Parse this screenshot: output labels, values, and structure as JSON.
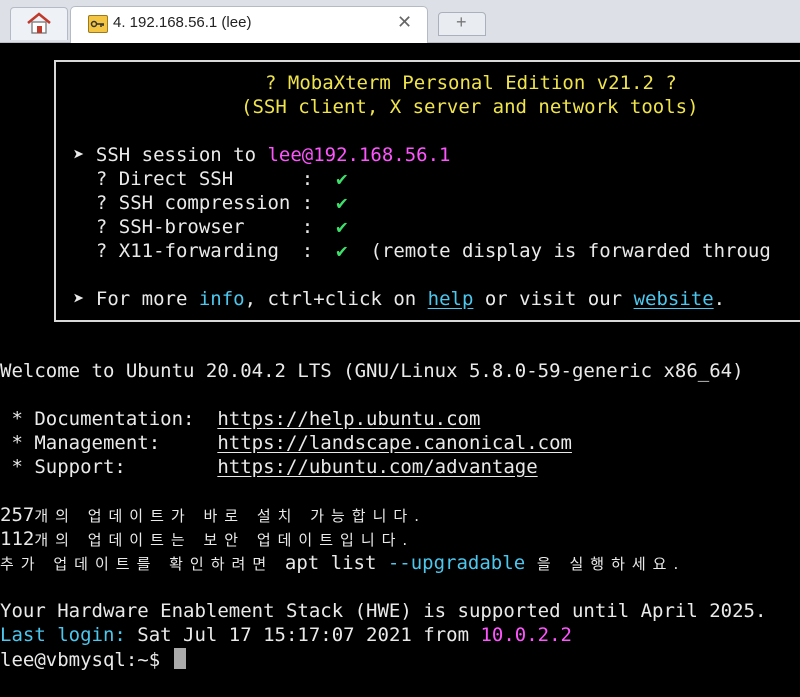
{
  "tabs": {
    "home_icon": "home-icon",
    "active": {
      "title": "4. 192.168.56.1 (lee)",
      "icon": "ssh-key-icon",
      "close": "✕"
    },
    "new_tab": "+"
  },
  "colors": {
    "yellow": "#f0e44b",
    "magenta": "#ff55ff",
    "green": "#3ce06a",
    "cyan": "#4cc7ee",
    "text": "#eaeaea"
  },
  "banner": {
    "title": "? MobaXterm Personal Edition v21.2 ?",
    "subtitle": "(SSH client, X server and network tools)",
    "session_prefix": "➤ SSH session to ",
    "session_host": "lee@192.168.56.1",
    "features": [
      {
        "label": "  ? Direct SSH      :  ",
        "check": "✔",
        "note": ""
      },
      {
        "label": "  ? SSH compression :  ",
        "check": "✔",
        "note": ""
      },
      {
        "label": "  ? SSH-browser     :  ",
        "check": "✔",
        "note": ""
      },
      {
        "label": "  ? X11-forwarding  :  ",
        "check": "✔",
        "note": "  (remote display is forwarded throug"
      }
    ],
    "more": {
      "p1": "➤ For more ",
      "info": "info",
      "p2": ", ctrl+click on ",
      "help": "help",
      "p3": " or visit our ",
      "website": "website",
      "p4": "."
    }
  },
  "welcome": "Welcome to Ubuntu 20.04.2 LTS (GNU/Linux 5.8.0-59-generic x86_64)",
  "docs": [
    {
      "label": " * Documentation:  ",
      "url": "https://help.ubuntu.com"
    },
    {
      "label": " * Management:     ",
      "url": "https://landscape.canonical.com"
    },
    {
      "label": " * Support:        ",
      "url": "https://ubuntu.com/advantage"
    }
  ],
  "updates": {
    "l1_num": "257",
    "l1_text": "개의 업데이트가 바로 설치 가능합니다.",
    "l2_num": "112",
    "l2_text": "개의 업데이트는 보안 업데이트입니다.",
    "l3_pre": "추가 업데이트를 확인하려면 ",
    "l3_cmd": "apt list ",
    "l3_opt": "--upgradable",
    "l3_post": " 을 실행하세요."
  },
  "hwe": "Your Hardware Enablement Stack (HWE) is supported until April 2025.",
  "last_login": {
    "label": "Last login:",
    "value": " Sat Jul 17 15:17:07 2021 from ",
    "ip": "10.0.2.2"
  },
  "prompt": "lee@vbmysql:~$ "
}
